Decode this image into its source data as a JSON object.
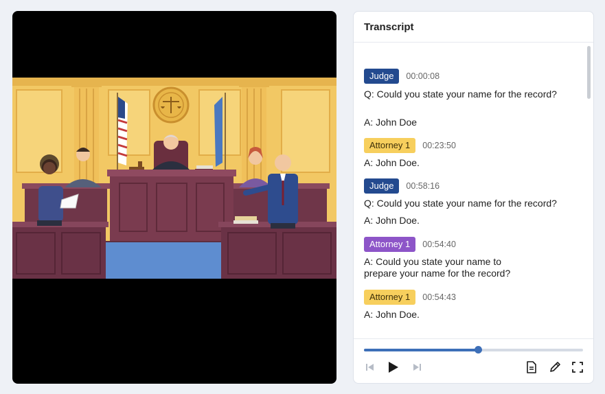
{
  "transcript": {
    "title": "Transcript",
    "entries": [
      {
        "speaker": "Judge",
        "time": "00:00:08",
        "lines": [
          "Q: Could you state your name for the record?"
        ],
        "extra": "A: John Doe"
      },
      {
        "speaker": "Attorney 1",
        "time": "00:23:50",
        "lines": [
          "A: John Doe."
        ]
      },
      {
        "speaker": "Judge",
        "time": "00:58:16",
        "lines": [
          "Q: Could you state your name for the record?",
          "A: John Doe."
        ]
      },
      {
        "speaker": "Attorney 1",
        "time": "00:54:40",
        "lines": [
          "A: Could you state your name to",
          "prepare your name for the record?"
        ]
      },
      {
        "speaker": "Attorney 1",
        "time": "00:54:43",
        "lines": [
          "A: John Doe."
        ]
      }
    ]
  },
  "player": {
    "progress_fraction": 0.52,
    "icons": [
      "skip-back-icon",
      "play-icon",
      "skip-forward-icon",
      "document-icon",
      "pencil-icon",
      "fullscreen-icon"
    ]
  },
  "colors": {
    "judge_badge": "#234a8f",
    "attorney_badge_yellow": "#f7cf5d",
    "attorney_badge_purple": "#8d55c8",
    "accent": "#3d6fb8"
  }
}
